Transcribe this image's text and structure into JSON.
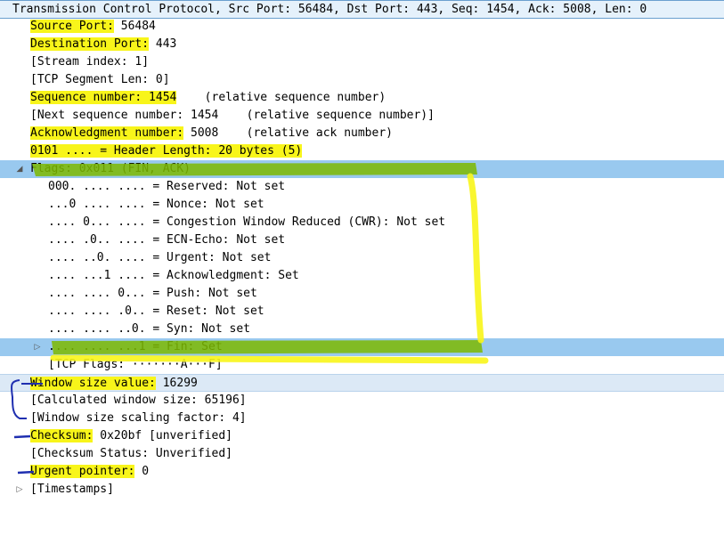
{
  "tree": {
    "root": "Transmission Control Protocol, Src Port: 56484, Dst Port: 443, Seq: 1454, Ack: 5008, Len: 0",
    "source_port": {
      "key": "Source Port:",
      "val": " 56484"
    },
    "destination_port": {
      "key": "Destination Port:",
      "val": " 443"
    },
    "stream_index": "[Stream index: 1]",
    "segment_len": "[TCP Segment Len: 0]",
    "seq": {
      "key": "Sequence number: 1454",
      "val": "    (relative sequence number)"
    },
    "next_seq": "[Next sequence number: 1454    (relative sequence number)]",
    "ack": {
      "key": "Acknowledgment number:",
      "val": " 5008    (relative ack number)"
    },
    "header_len": "0101 .... = Header Length: 20 bytes (5)",
    "flags": "Flags: 0x011 (FIN, ACK)",
    "flag_rows": [
      "000. .... .... = Reserved: Not set",
      "...0 .... .... = Nonce: Not set",
      ".... 0... .... = Congestion Window Reduced (CWR): Not set",
      ".... .0.. .... = ECN-Echo: Not set",
      ".... ..0. .... = Urgent: Not set",
      ".... ...1 .... = Acknowledgment: Set",
      ".... .... 0... = Push: Not set",
      ".... .... .0.. = Reset: Not set",
      ".... .... ..0. = Syn: Not set",
      ".... .... ...1 = Fin: Set"
    ],
    "tcp_flags": "[TCP Flags: ·······A···F]",
    "window": {
      "key": "Window size value:",
      "val": " 16299"
    },
    "calc_window": "[Calculated window size: 65196]",
    "scaling": "[Window size scaling factor: 4]",
    "checksum": {
      "key": "Checksum:",
      "val": " 0x20bf [unverified]"
    },
    "checksum_status": "[Checksum Status: Unverified]",
    "urgent": {
      "key": "Urgent pointer:",
      "val": " 0"
    },
    "timestamps": "[Timestamps]"
  },
  "colors": {
    "selection": "#99c9ef",
    "highlighter_yellow": "#f8f51a",
    "highlighter_green": "#7cb800",
    "pen_blue": "#1f2fb0"
  },
  "icons": {
    "expanded": "triangle-down-icon",
    "collapsed": "triangle-right-icon"
  }
}
